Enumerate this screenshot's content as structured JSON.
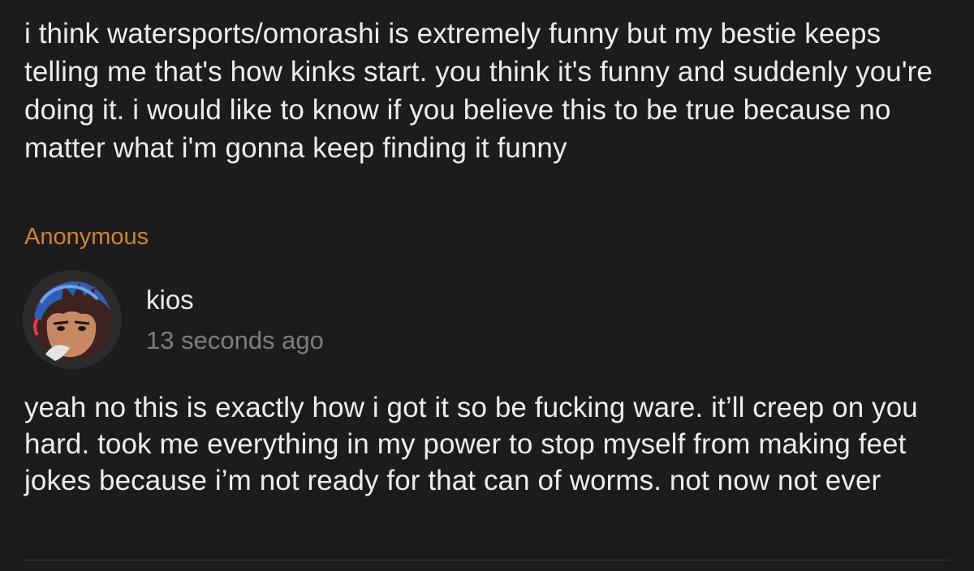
{
  "question": {
    "text": "i think watersports/omorashi is extremely funny but my bestie keeps telling me that's how kinks start. you think it's funny and suddenly you're doing it. i would like to know if you believe this to be true because no matter what i'm gonna keep finding it funny",
    "asker": "Anonymous"
  },
  "answer": {
    "avatar_icon": "anime-character-avatar-icon",
    "username": "kios",
    "timestamp": "13 seconds ago",
    "text": "yeah no this is exactly how i got it so be fucking ware. it’ll creep on you hard. took me everything in my power to stop myself from making feet jokes because i’m not ready for that can of worms. not now not ever"
  },
  "colors": {
    "background": "#1c1c1e",
    "text": "#ededed",
    "asker": "#d1822f",
    "timestamp": "#7d7d82"
  }
}
